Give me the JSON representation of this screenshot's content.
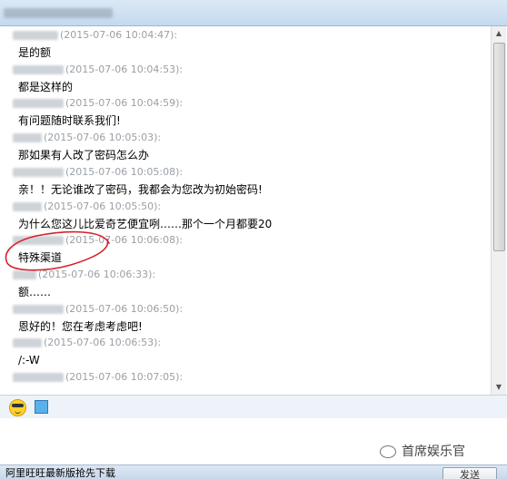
{
  "window": {
    "title_blurred": true
  },
  "messages": [
    {
      "time": "(2015-07-06 10:04:47):",
      "text": "是的额",
      "sender_w": 50
    },
    {
      "time": "(2015-07-06 10:04:53):",
      "text": "都是这样的",
      "sender_w": 56
    },
    {
      "time": "(2015-07-06 10:04:59):",
      "text": "有问题随时联系我们!",
      "sender_w": 56
    },
    {
      "time": "(2015-07-06 10:05:03):",
      "text": "那如果有人改了密码怎么办",
      "sender_w": 32
    },
    {
      "time": "(2015-07-06 10:05:08):",
      "text": "亲！！无论谁改了密码，我都会为您改为初始密码!",
      "sender_w": 56
    },
    {
      "time": "(2015-07-06 10:05:50):",
      "text": "为什么您这儿比爱奇艺便宜咧……那个一个月都要20",
      "sender_w": 32
    },
    {
      "time": "(2015-07-06 10:06:08):",
      "text": "特殊渠道",
      "sender_w": 56
    },
    {
      "time": "(2015-07-06 10:06:33):",
      "text": "额……",
      "sender_w": 26
    },
    {
      "time": "(2015-07-06 10:06:50):",
      "text": "恩好的！您在考虑考虑吧!",
      "sender_w": 56
    },
    {
      "time": "(2015-07-06 10:06:53):",
      "text": "/:-W",
      "sender_w": 32
    },
    {
      "time": "(2015-07-06 10:07:05):",
      "text": "",
      "sender_w": 56
    }
  ],
  "toolbar": {
    "emoji_icon": "sunglasses-emoji-icon",
    "screenshot_icon": "screenshot-icon"
  },
  "footer": {
    "ad_text": "阿里旺旺最新版抢先下载",
    "send_label": "发送"
  },
  "watermark": {
    "text": "首席娱乐官"
  },
  "colors": {
    "timestamp": "#9aa0a6",
    "annotation": "#d9202a",
    "titlebar": "#c4d9ee"
  }
}
